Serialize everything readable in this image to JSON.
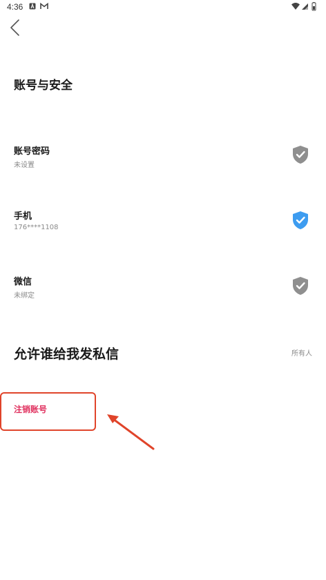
{
  "status_bar": {
    "time": "4:36",
    "notification_icons": [
      "a-icon",
      "gmail-icon"
    ],
    "right_icons": [
      "wifi-icon",
      "signal-icon",
      "battery-icon"
    ]
  },
  "nav": {
    "back_icon": "chevron-left-icon"
  },
  "page": {
    "title": "账号与安全"
  },
  "security_items": [
    {
      "title": "账号密码",
      "subtitle": "未设置",
      "shield_icon": "shield-check-icon",
      "shield_color": "#8f8f8f",
      "verified": false
    },
    {
      "title": "手机",
      "subtitle": "176****1108",
      "shield_icon": "shield-check-icon",
      "shield_color": "#3d9cf0",
      "verified": true
    },
    {
      "title": "微信",
      "subtitle": "未绑定",
      "shield_icon": "shield-check-icon",
      "shield_color": "#8f8f8f",
      "verified": false
    }
  ],
  "private_message": {
    "title": "允许谁给我发私信",
    "value": "所有人"
  },
  "cancel_account": {
    "label": "注销账号",
    "color": "#e0305e"
  },
  "annotation": {
    "highlight_color": "#e0442a"
  }
}
